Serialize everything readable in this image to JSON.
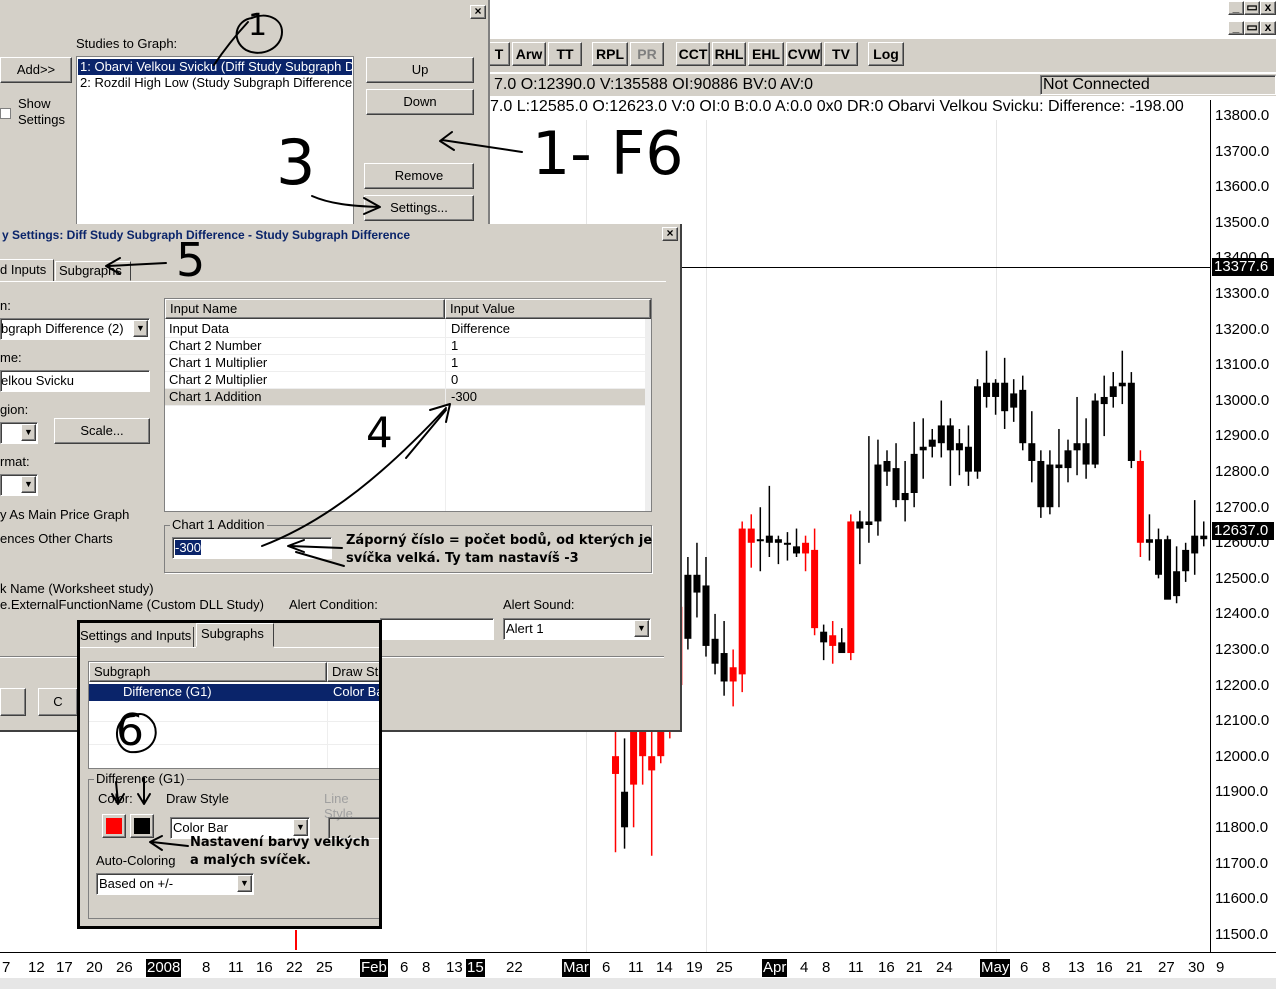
{
  "window_controls": [
    "_",
    "▭",
    "x"
  ],
  "toolbar": {
    "buttons": [
      {
        "label": "T",
        "enabled": true
      },
      {
        "label": "Arw",
        "enabled": true
      },
      {
        "label": "TT",
        "enabled": true
      },
      {
        "label": "RPL",
        "enabled": true
      },
      {
        "label": "PR",
        "enabled": false
      },
      {
        "label": "CCT",
        "enabled": true
      },
      {
        "label": "RHL",
        "enabled": true
      },
      {
        "label": "EHL",
        "enabled": true
      },
      {
        "label": "CVW",
        "enabled": true
      },
      {
        "label": "TV",
        "enabled": true
      },
      {
        "label": "Log",
        "enabled": true
      }
    ]
  },
  "status": {
    "line1": "7.0  O:12390.0  V:135588  OI:90886  BV:0  AV:0",
    "connection": "Not Connected",
    "line2": "7.0  L:12585.0  O:12623.0  V:0  OI:0  B:0.0  A:0.0  0x0  DR:0  Obarvi Velkou Svicku:  Difference: -198.00"
  },
  "studies_dialog": {
    "studies_label": "Studies to Graph:",
    "studies": [
      "1: Obarvi Velkou Svicku (Diff Study Subgraph D",
      "2: Rozdil High Low (Study Subgraph Difference"
    ],
    "add_label": "Add>>",
    "show_settings_label": "Show\nSettings",
    "up_label": "Up",
    "down_label": "Down",
    "remove_label": "Remove",
    "settings_label": "Settings..."
  },
  "settings_dialog": {
    "title": "y Settings: Diff Study Subgraph Difference - Study Subgraph Difference",
    "tabs": [
      "d Inputs",
      "Subgraphs"
    ],
    "field_labels": [
      "n:",
      "me:",
      "gion:",
      "rmat:"
    ],
    "study_combo_value": "bgraph Difference (2)",
    "name_value": "elkou Svicku",
    "scale_label": "Scale...",
    "main_price_label": "y As Main Price Graph",
    "other_charts_label": "ences Other Charts",
    "table_headers": [
      "Input Name",
      "Input Value"
    ],
    "inputs": [
      {
        "name": "Input Data",
        "value": "Difference"
      },
      {
        "name": "Chart 2 Number",
        "value": "1"
      },
      {
        "name": "Chart 1 Multiplier",
        "value": "1"
      },
      {
        "name": "Chart 2 Multiplier",
        "value": "0"
      },
      {
        "name": "Chart 1 Addition",
        "value": "-300"
      }
    ],
    "edit_group_label": "Chart 1 Addition",
    "edit_value": "-300",
    "worksheet_label": "k Name (Worksheet study)",
    "dll_label": "e.ExternalFunctionName (Custom DLL Study)",
    "alert_condition_label": "Alert Condition:",
    "alert_sound_label": "Alert Sound:",
    "alert_sound_value": "Alert 1"
  },
  "subgraphs_panel": {
    "tabs": [
      "Settings and Inputs",
      "Subgraphs"
    ],
    "headers": [
      "Subgraph",
      "Draw St"
    ],
    "row": {
      "subgraph": "Difference (G1)",
      "draw": "Color Ba"
    },
    "group_label": "Difference (G1)",
    "color_label": "Color:",
    "draw_style_label": "Draw Style",
    "line_style_label": "Line Style",
    "draw_style_value": "Color Bar",
    "auto_coloring_label": "Auto-Coloring",
    "auto_coloring_value": "Based on +/-",
    "color_up": "#ff0000",
    "color_down": "#000000"
  },
  "annotations": {
    "n1": "1",
    "f6": "1- F6",
    "n3": "3",
    "n4": "4",
    "n5": "5",
    "n6": "6",
    "note1": "Záporný číslo = počet bodů, od kterých je\nsvíčka velká. Ty tam nastavíš -3",
    "note2": "Nastavení barvy velkých\na malých svíček."
  },
  "price_axis": {
    "ticks": [
      "13800.0",
      "13700.0",
      "13600.0",
      "13500.0",
      "13400.0",
      "13300.0",
      "13200.0",
      "13100.0",
      "13000.0",
      "12900.0",
      "12800.0",
      "12700.0",
      "12600.0",
      "12500.0",
      "12400.0",
      "12300.0",
      "12200.0",
      "12100.0",
      "12000.0",
      "11900.0",
      "11800.0",
      "11700.0",
      "11600.0",
      "11500.0"
    ],
    "highlight_upper": "13377.6",
    "highlight_lower": "12637.0"
  },
  "date_axis": {
    "labels": [
      {
        "t": "7"
      },
      {
        "t": "12"
      },
      {
        "t": "17"
      },
      {
        "t": "20"
      },
      {
        "t": "26"
      },
      {
        "t": "2008",
        "hl": true
      },
      {
        "t": "8"
      },
      {
        "t": "11"
      },
      {
        "t": "16"
      },
      {
        "t": "22"
      },
      {
        "t": "25"
      },
      {
        "t": "Feb",
        "hl": true
      },
      {
        "t": "6"
      },
      {
        "t": "8"
      },
      {
        "t": "13"
      },
      {
        "t": "15",
        "hl": true
      },
      {
        "t": "22"
      },
      {
        "t": "Mar",
        "hl": true
      },
      {
        "t": "6"
      },
      {
        "t": "11"
      },
      {
        "t": "14"
      },
      {
        "t": "19"
      },
      {
        "t": "25"
      },
      {
        "t": "Apr",
        "hl": true
      },
      {
        "t": "4"
      },
      {
        "t": "8"
      },
      {
        "t": "11"
      },
      {
        "t": "16"
      },
      {
        "t": "21"
      },
      {
        "t": "24"
      },
      {
        "t": "May",
        "hl": true
      },
      {
        "t": "6"
      },
      {
        "t": "8"
      },
      {
        "t": "13"
      },
      {
        "t": "16"
      },
      {
        "t": "21"
      },
      {
        "t": "27"
      },
      {
        "t": "30"
      },
      {
        "t": "9"
      }
    ]
  },
  "chart_data": {
    "type": "candlestick",
    "up_color": "#ff0000",
    "down_color": "#000000",
    "ylim": [
      11450,
      13850
    ],
    "candles": [
      {
        "o": 11950,
        "h": 12130,
        "l": 11730,
        "c": 12000,
        "col": "r"
      },
      {
        "o": 11900,
        "h": 12050,
        "l": 11740,
        "c": 11800,
        "col": "k"
      },
      {
        "o": 11920,
        "h": 12100,
        "l": 11800,
        "c": 12100,
        "col": "r"
      },
      {
        "o": 12000,
        "h": 12180,
        "l": 11920,
        "c": 12120,
        "col": "r"
      },
      {
        "o": 11960,
        "h": 12140,
        "l": 11720,
        "c": 12000,
        "col": "r"
      },
      {
        "o": 12000,
        "h": 12260,
        "l": 11980,
        "c": 12240,
        "col": "r"
      },
      {
        "o": 12110,
        "h": 12300,
        "l": 12050,
        "c": 12280,
        "col": "r"
      },
      {
        "o": 12200,
        "h": 12460,
        "l": 12080,
        "c": 12420,
        "col": "r"
      },
      {
        "o": 12330,
        "h": 12560,
        "l": 12300,
        "c": 12510,
        "col": "k"
      },
      {
        "o": 12510,
        "h": 12600,
        "l": 12390,
        "c": 12460,
        "col": "k"
      },
      {
        "o": 12480,
        "h": 12560,
        "l": 12280,
        "c": 12310,
        "col": "k"
      },
      {
        "o": 12330,
        "h": 12400,
        "l": 12230,
        "c": 12260,
        "col": "k"
      },
      {
        "o": 12290,
        "h": 12380,
        "l": 12170,
        "c": 12210,
        "col": "k"
      },
      {
        "o": 12210,
        "h": 12300,
        "l": 12140,
        "c": 12250,
        "col": "r"
      },
      {
        "o": 12230,
        "h": 12660,
        "l": 12180,
        "c": 12640,
        "col": "r"
      },
      {
        "o": 12640,
        "h": 12680,
        "l": 12530,
        "c": 12600,
        "col": "r"
      },
      {
        "o": 12610,
        "h": 12700,
        "l": 12520,
        "c": 12610,
        "col": "k"
      },
      {
        "o": 12620,
        "h": 12760,
        "l": 12560,
        "c": 12600,
        "col": "k"
      },
      {
        "o": 12610,
        "h": 12620,
        "l": 12540,
        "c": 12600,
        "col": "k"
      },
      {
        "o": 12600,
        "h": 12630,
        "l": 12550,
        "c": 12600,
        "col": "k"
      },
      {
        "o": 12590,
        "h": 12640,
        "l": 12560,
        "c": 12570,
        "col": "k"
      },
      {
        "o": 12570,
        "h": 12620,
        "l": 12520,
        "c": 12600,
        "col": "r"
      },
      {
        "o": 12580,
        "h": 12640,
        "l": 12340,
        "c": 12360,
        "col": "r"
      },
      {
        "o": 12350,
        "h": 12370,
        "l": 12270,
        "c": 12320,
        "col": "k"
      },
      {
        "o": 12310,
        "h": 12380,
        "l": 12260,
        "c": 12340,
        "col": "r"
      },
      {
        "o": 12320,
        "h": 12360,
        "l": 12300,
        "c": 12290,
        "col": "k"
      },
      {
        "o": 12290,
        "h": 12680,
        "l": 12270,
        "c": 12660,
        "col": "r"
      },
      {
        "o": 12660,
        "h": 12690,
        "l": 12540,
        "c": 12640,
        "col": "k"
      },
      {
        "o": 12650,
        "h": 12900,
        "l": 12600,
        "c": 12660,
        "col": "k"
      },
      {
        "o": 12660,
        "h": 12890,
        "l": 12620,
        "c": 12820,
        "col": "k"
      },
      {
        "o": 12830,
        "h": 12860,
        "l": 12760,
        "c": 12800,
        "col": "k"
      },
      {
        "o": 12810,
        "h": 12880,
        "l": 12700,
        "c": 12720,
        "col": "k"
      },
      {
        "o": 12720,
        "h": 12830,
        "l": 12660,
        "c": 12740,
        "col": "k"
      },
      {
        "o": 12740,
        "h": 12940,
        "l": 12700,
        "c": 12850,
        "col": "k"
      },
      {
        "o": 12860,
        "h": 12950,
        "l": 12780,
        "c": 12870,
        "col": "k"
      },
      {
        "o": 12870,
        "h": 12920,
        "l": 12840,
        "c": 12890,
        "col": "k"
      },
      {
        "o": 12880,
        "h": 13000,
        "l": 12840,
        "c": 12930,
        "col": "k"
      },
      {
        "o": 12930,
        "h": 12950,
        "l": 12760,
        "c": 12860,
        "col": "k"
      },
      {
        "o": 12860,
        "h": 12920,
        "l": 12790,
        "c": 12880,
        "col": "k"
      },
      {
        "o": 12870,
        "h": 12930,
        "l": 12760,
        "c": 12800,
        "col": "k"
      },
      {
        "o": 12800,
        "h": 13060,
        "l": 12780,
        "c": 13040,
        "col": "k"
      },
      {
        "o": 13050,
        "h": 13140,
        "l": 12980,
        "c": 13010,
        "col": "k"
      },
      {
        "o": 13010,
        "h": 13060,
        "l": 12960,
        "c": 13050,
        "col": "k"
      },
      {
        "o": 13050,
        "h": 13120,
        "l": 12920,
        "c": 12970,
        "col": "k"
      },
      {
        "o": 12980,
        "h": 13060,
        "l": 12940,
        "c": 13020,
        "col": "k"
      },
      {
        "o": 13030,
        "h": 13070,
        "l": 12860,
        "c": 12880,
        "col": "k"
      },
      {
        "o": 12880,
        "h": 12970,
        "l": 12770,
        "c": 12830,
        "col": "k"
      },
      {
        "o": 12830,
        "h": 12860,
        "l": 12670,
        "c": 12700,
        "col": "k"
      },
      {
        "o": 12700,
        "h": 12860,
        "l": 12680,
        "c": 12820,
        "col": "k"
      },
      {
        "o": 12820,
        "h": 12920,
        "l": 12700,
        "c": 12810,
        "col": "k"
      },
      {
        "o": 12810,
        "h": 12890,
        "l": 12770,
        "c": 12860,
        "col": "k"
      },
      {
        "o": 12860,
        "h": 13010,
        "l": 12790,
        "c": 12880,
        "col": "k"
      },
      {
        "o": 12880,
        "h": 12950,
        "l": 12780,
        "c": 12820,
        "col": "k"
      },
      {
        "o": 12820,
        "h": 13020,
        "l": 12810,
        "c": 13000,
        "col": "k"
      },
      {
        "o": 12990,
        "h": 13070,
        "l": 12900,
        "c": 13010,
        "col": "k"
      },
      {
        "o": 13010,
        "h": 13080,
        "l": 12980,
        "c": 13040,
        "col": "k"
      },
      {
        "o": 13040,
        "h": 13140,
        "l": 12990,
        "c": 13050,
        "col": "k"
      },
      {
        "o": 13050,
        "h": 13080,
        "l": 12810,
        "c": 12830,
        "col": "k"
      },
      {
        "o": 12830,
        "h": 12860,
        "l": 12560,
        "c": 12600,
        "col": "r"
      },
      {
        "o": 12600,
        "h": 12680,
        "l": 12550,
        "c": 12610,
        "col": "k"
      },
      {
        "o": 12610,
        "h": 12640,
        "l": 12500,
        "c": 12510,
        "col": "k"
      },
      {
        "o": 12610,
        "h": 12620,
        "l": 12450,
        "c": 12440,
        "col": "k"
      },
      {
        "o": 12450,
        "h": 12590,
        "l": 12430,
        "c": 12520,
        "col": "k"
      },
      {
        "o": 12520,
        "h": 12600,
        "l": 12490,
        "c": 12580,
        "col": "k"
      },
      {
        "o": 12570,
        "h": 12720,
        "l": 12510,
        "c": 12620,
        "col": "k"
      },
      {
        "o": 12620,
        "h": 12660,
        "l": 12590,
        "c": 12610,
        "col": "k"
      }
    ]
  }
}
